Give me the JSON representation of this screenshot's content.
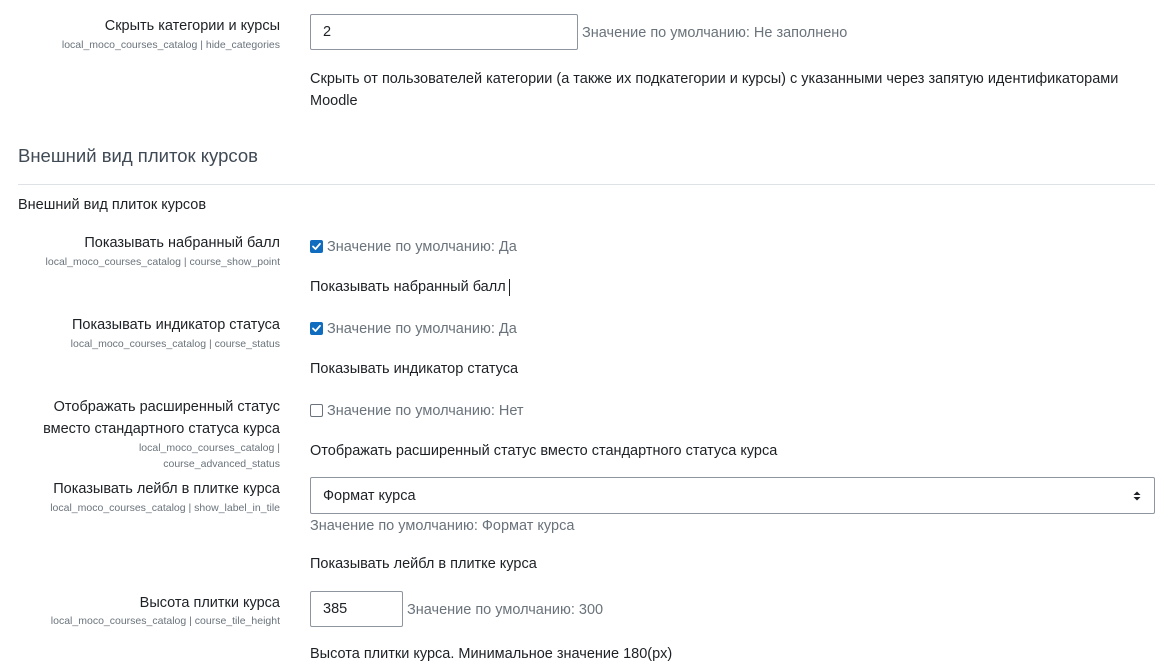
{
  "settings": {
    "hide_categories": {
      "label": "Скрыть категории и курсы",
      "key": "local_moco_courses_catalog | hide_categories",
      "value": "2",
      "default": "Значение по умолчанию: Не заполнено",
      "desc_line1": "Скрыть от пользователей категории (а также их подкатегории и курсы) с указанными через запятую идентификаторами",
      "desc_line2": "Moodle"
    },
    "section": {
      "title": "Внешний вид плиток курсов",
      "subtitle": "Внешний вид плиток курсов"
    },
    "show_point": {
      "label": "Показывать набранный балл",
      "key": "local_moco_courses_catalog | course_show_point",
      "checked": true,
      "default": "Значение по умолчанию: Да",
      "desc": "Показывать набранный балл"
    },
    "course_status": {
      "label": "Показывать индикатор статуса",
      "key": "local_moco_courses_catalog | course_status",
      "checked": true,
      "default": "Значение по умолчанию: Да",
      "desc": "Показывать индикатор статуса"
    },
    "advanced_status": {
      "label_line1": "Отображать расширенный статус",
      "label_line2": "вместо стандартного статуса курса",
      "key_line1": "local_moco_courses_catalog |",
      "key_line2": "course_advanced_status",
      "checked": false,
      "default": "Значение по умолчанию: Нет",
      "desc": "Отображать расширенный статус вместо стандартного статуса курса"
    },
    "show_label": {
      "label": "Показывать лейбл в плитке курса",
      "key": "local_moco_courses_catalog | show_label_in_tile",
      "selected": "Формат курса",
      "default": "Значение по умолчанию: Формат курса",
      "desc": "Показывать лейбл в плитке курса"
    },
    "tile_height": {
      "label": "Высота плитки курса",
      "key": "local_moco_courses_catalog | course_tile_height",
      "value": "385",
      "default": "Значение по умолчанию: 300",
      "desc": "Высота плитки курса. Минимальное значение 180(px)"
    }
  },
  "colors": {
    "accent": "#0f6cbf",
    "muted": "#6a737b",
    "text": "#1d2125",
    "border": "#8f959e"
  },
  "icons": {
    "checkbox": "checkbox-icon",
    "select_arrows": "select-arrows-icon"
  }
}
